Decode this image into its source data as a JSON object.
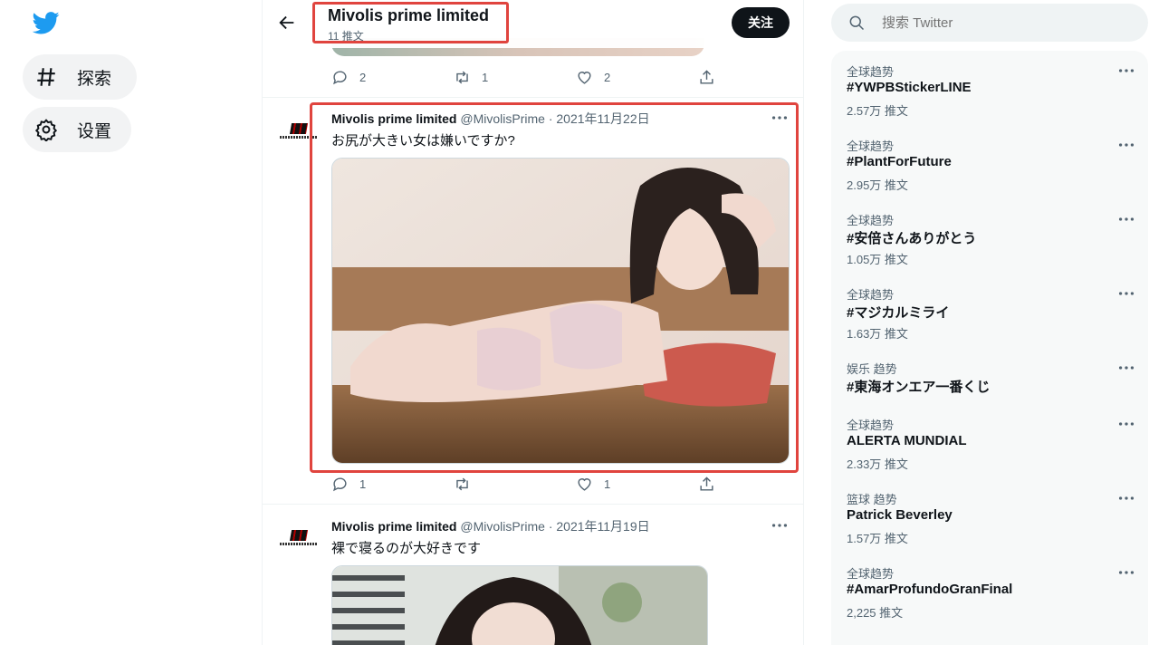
{
  "nav": {
    "explore_label": "探索",
    "settings_label": "设置"
  },
  "header": {
    "title": "Mivolis prime limited",
    "subtitle": "11 推文",
    "follow_label": "关注"
  },
  "top_tweet_actions": {
    "reply_count": "2",
    "retweet_count": "1",
    "like_count": "2"
  },
  "tweets": [
    {
      "name": "Mivolis prime limited",
      "meta": "@MivolisPrime · 2021年11月22日",
      "text": "お尻が大きい女は嫌いですか?",
      "reply_count": "1",
      "retweet_count": "",
      "like_count": "1"
    },
    {
      "name": "Mivolis prime limited",
      "meta": "@MivolisPrime · 2021年11月19日",
      "text": "裸で寝るのが大好きです"
    }
  ],
  "search": {
    "placeholder": "搜索 Twitter"
  },
  "trends": [
    {
      "category": "全球趋势",
      "tag": "#YWPBStickerLINE",
      "count": "2.57万 推文"
    },
    {
      "category": "全球趋势",
      "tag": "#PlantForFuture",
      "count": "2.95万 推文"
    },
    {
      "category": "全球趋势",
      "tag": "#安倍さんありがとう",
      "count": "1.05万 推文"
    },
    {
      "category": "全球趋势",
      "tag": "#マジカルミライ",
      "count": "1.63万 推文"
    },
    {
      "category": "娱乐 趋势",
      "tag": "#東海オンエア一番くじ",
      "count": ""
    },
    {
      "category": "全球趋势",
      "tag": "ALERTA MUNDIAL",
      "count": "2.33万 推文"
    },
    {
      "category": "篮球 趋势",
      "tag": "Patrick Beverley",
      "count": "1.57万 推文"
    },
    {
      "category": "全球趋势",
      "tag": "#AmarProfundoGranFinal",
      "count": "2,225 推文"
    }
  ],
  "colors": {
    "accent": "#1d9bf0",
    "highlight": "#e0443e",
    "text": "#0f1419",
    "muted": "#536471"
  },
  "icons": [
    "twitter-bird-icon",
    "hashtag-icon",
    "gear-icon",
    "back-arrow-icon",
    "reply-icon",
    "retweet-icon",
    "like-icon",
    "share-icon",
    "more-icon",
    "search-icon"
  ]
}
